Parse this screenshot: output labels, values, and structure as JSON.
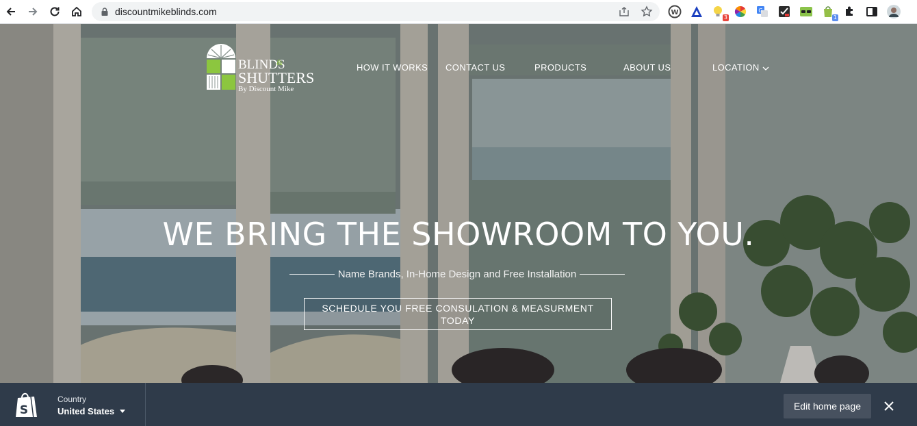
{
  "browser": {
    "url": "discountmikeblinds.com",
    "extension_badges": {
      "ext3": "3",
      "ext8": "1"
    }
  },
  "logo": {
    "line1": "BLINDS",
    "amp": "&",
    "line2": "SHUTTERS",
    "tagline": "By Discount Mike",
    "accent_color": "#8cc63f"
  },
  "nav": {
    "items": [
      {
        "label": "HOW IT WORKS"
      },
      {
        "label": "CONTACT US"
      },
      {
        "label": "PRODUCTS"
      },
      {
        "label": "ABOUT US"
      },
      {
        "label": "LOCATION"
      }
    ]
  },
  "hero": {
    "headline": "WE BRING THE SHOWROOM TO YOU.",
    "subheadline": "Name Brands, In-Home Design and Free Installation",
    "cta_line1": "SCHEDULE YOU FREE CONSULATION & MEASURMENT",
    "cta_line2": "TODAY"
  },
  "preview_bar": {
    "country_label": "Country",
    "country_value": "United States",
    "edit_button": "Edit home page",
    "background": "#2f3b4a"
  }
}
